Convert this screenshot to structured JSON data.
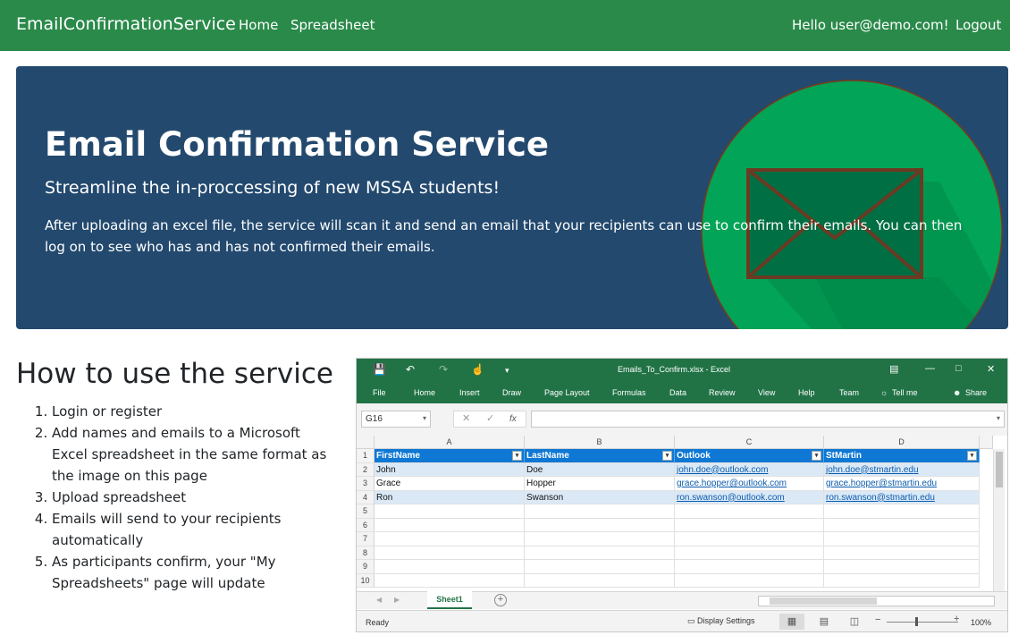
{
  "navbar": {
    "brand": "EmailConfirmationService",
    "home": "Home",
    "spreadsheet": "Spreadsheet",
    "greeting": "Hello user@demo.com!",
    "logout": "Logout",
    "color": "#2a8a4a"
  },
  "hero": {
    "title": "Email Confirmation Service",
    "subtitle": "Streamline the in-proccessing of new MSSA students!",
    "description": "After uploading an excel file, the service will scan it and send an email that your recipients can use to confirm their emails. You can then log on to see who has and has not confirmed their emails.",
    "background": "#23496e",
    "illustration": "envelope-icon"
  },
  "howto": {
    "title": "How to use the service",
    "steps": [
      "Login or register",
      "Add names and emails to a Microsoft Excel spreadsheet in the same format as the image on this page",
      "Upload spreadsheet",
      "Emails will send to your recipients automatically",
      "As participants confirm, your \"My Spreadsheets\" page will update"
    ]
  },
  "excel": {
    "window_title": "Emails_To_Confirm.xlsx  -  Excel",
    "menu": [
      "File",
      "Home",
      "Insert",
      "Draw",
      "Page Layout",
      "Formulas",
      "Data",
      "Review",
      "View",
      "Help",
      "Team",
      "Tell me",
      "Share"
    ],
    "name_box": "G16",
    "fx_label": "fx",
    "columns": [
      "A",
      "B",
      "C",
      "D"
    ],
    "headers": [
      "FirstName",
      "LastName",
      "Outlook",
      "StMartin"
    ],
    "rows": [
      [
        "John",
        "Doe",
        "john.doe@outlook.com",
        "john.doe@stmartin.edu"
      ],
      [
        "Grace",
        "Hopper",
        "grace.hopper@outlook.com",
        "grace.hopper@stmartin.edu"
      ],
      [
        "Ron",
        "Swanson",
        "ron.swanson@outlook.com",
        "ron.swanson@stmartin.edu"
      ]
    ],
    "row_numbers": [
      "1",
      "2",
      "3",
      "4",
      "5",
      "6",
      "7",
      "8",
      "9",
      "10"
    ],
    "sheet_tab": "Sheet1",
    "status_ready": "Ready",
    "display_settings": "Display Settings",
    "zoom": "100%",
    "accent": "#217346",
    "table_header_color": "#0f78d4"
  }
}
